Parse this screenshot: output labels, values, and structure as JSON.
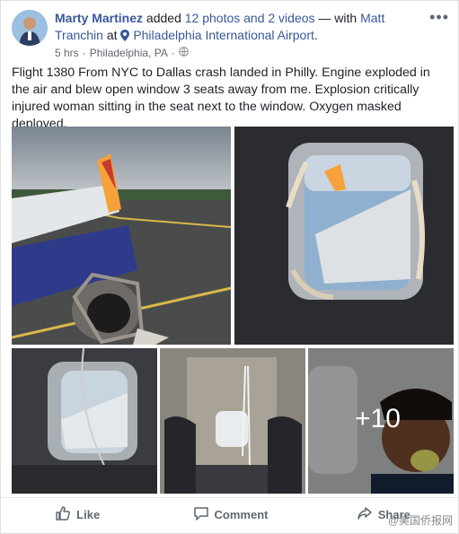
{
  "post": {
    "author": "Marty Martinez",
    "verb": "added",
    "media_count": "12 photos and 2 videos",
    "with_text": "— with",
    "tagged_person": "Matt Tranchin",
    "at_text": "at",
    "location_icon": "pin-icon",
    "location": "Philadelphia International Airport",
    "period": ".",
    "time": "5 hrs",
    "separator": "·",
    "place": "Philadelphia, PA",
    "separator2": "·",
    "privacy_icon": "globe-icon",
    "more_label": "•••",
    "text": "Flight 1380 From NYC to Dallas crash landed in Philly. Engine exploded in the air and blew open window 3 seats away from me. Explosion critically injured woman sitting in the seat next to the window. Oxygen masked deployed."
  },
  "gallery": {
    "more_count": "+10"
  },
  "actions": {
    "like": "Like",
    "comment": "Comment",
    "share": "Share"
  },
  "watermark": "@美国侨报网"
}
